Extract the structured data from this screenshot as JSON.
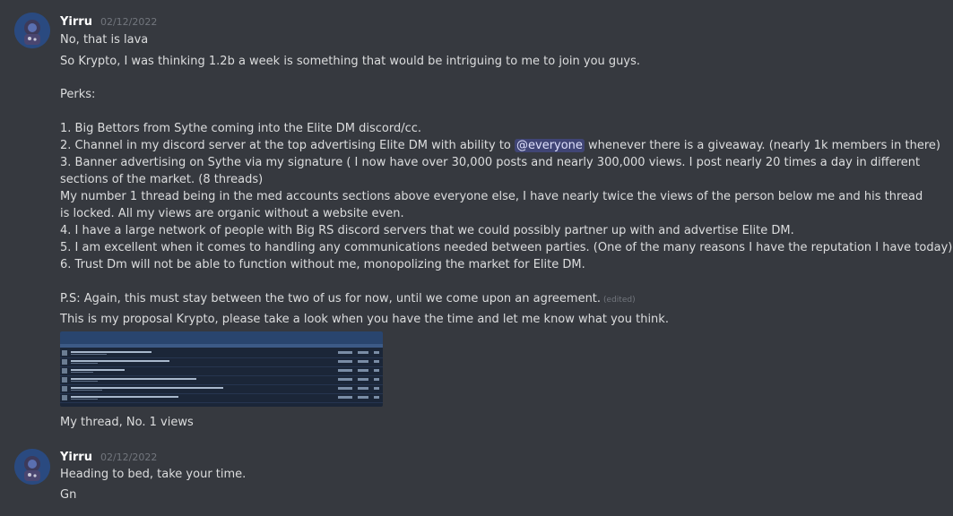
{
  "messages": [
    {
      "username": "Yirru",
      "timestamp": "02/12/2022",
      "lines": {
        "l1": "No, that is lava",
        "l2": "So Krypto, I was thinking 1.2b a week is something that would be intriguing to me to join you guys.",
        "l3": "Perks:",
        "l4": "1. Big Bettors from Sythe coming into the Elite DM discord/cc.",
        "l5a": "2. Channel in my discord server at the top advertising Elite DM with ability to ",
        "l5_mention": "@everyone",
        "l5b": " whenever there is a giveaway. (nearly 1k members in there)",
        "l6": "3. Banner advertising on Sythe via my signature ( I now have over 30,000 posts and nearly 300,000 views. I post nearly 20 times a day in different sections of the market. (8 threads)",
        "l7": "My number 1 thread being in the med accounts sections above everyone else, I have nearly twice the views of the person below me and his thread is locked. All my views are organic without a website even.",
        "l8": "4. I have a large network of people with Big RS discord servers that we could possibly partner up with and advertise Elite DM.",
        "l9": "5. I am excellent when it comes to handling any communications needed between parties. (One of the many reasons I have the reputation I have today)",
        "l10": "6. Trust Dm will not be able to function without me, monopolizing the market for Elite DM.",
        "l11": "P.S: Again, this must stay between the two of us for now, until we come upon an agreement.",
        "l11_edited": "(edited)",
        "l12": "This is my proposal Krypto, please take a look when you have the time and let me know what you think.",
        "l13": "My thread, No. 1 views"
      }
    },
    {
      "username": "Yirru",
      "timestamp": "02/12/2022",
      "lines": {
        "l1": "Heading to bed, take your time.",
        "l2": "Gn"
      }
    }
  ],
  "icons": {
    "avatar": "astronaut-avatar-icon"
  },
  "colors": {
    "background": "#36393f",
    "username": "#ffffff",
    "timestamp": "#72767d",
    "text": "#dcddde",
    "mention_bg": "#414675",
    "mention_text": "#dee0fc"
  }
}
